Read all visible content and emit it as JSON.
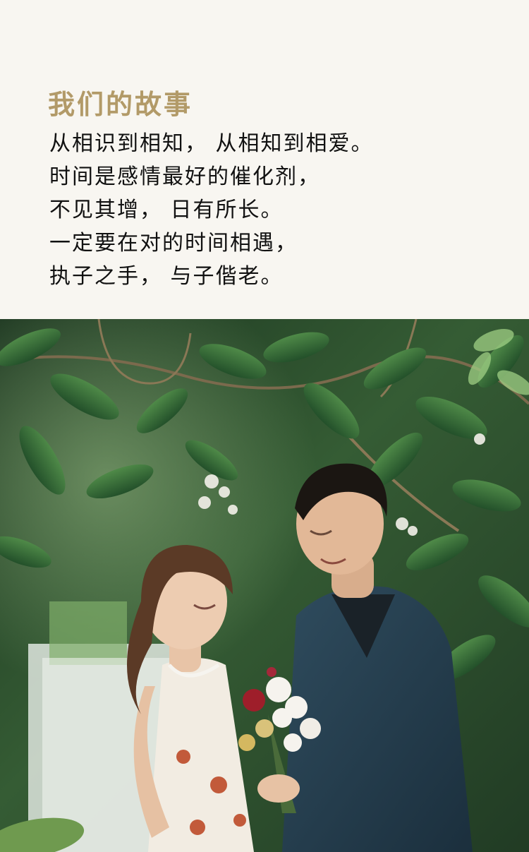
{
  "story": {
    "title": "我们的故事",
    "lines": [
      "从相识到相知， 从相知到相爱。",
      "时间是感情最好的催化剂，",
      "不见其增， 日有所长。",
      "一定要在对的时间相遇，",
      "执子之手， 与子偕老。"
    ]
  },
  "colors": {
    "background": "#f8f6f1",
    "title": "#b29a68",
    "text": "#111111"
  }
}
